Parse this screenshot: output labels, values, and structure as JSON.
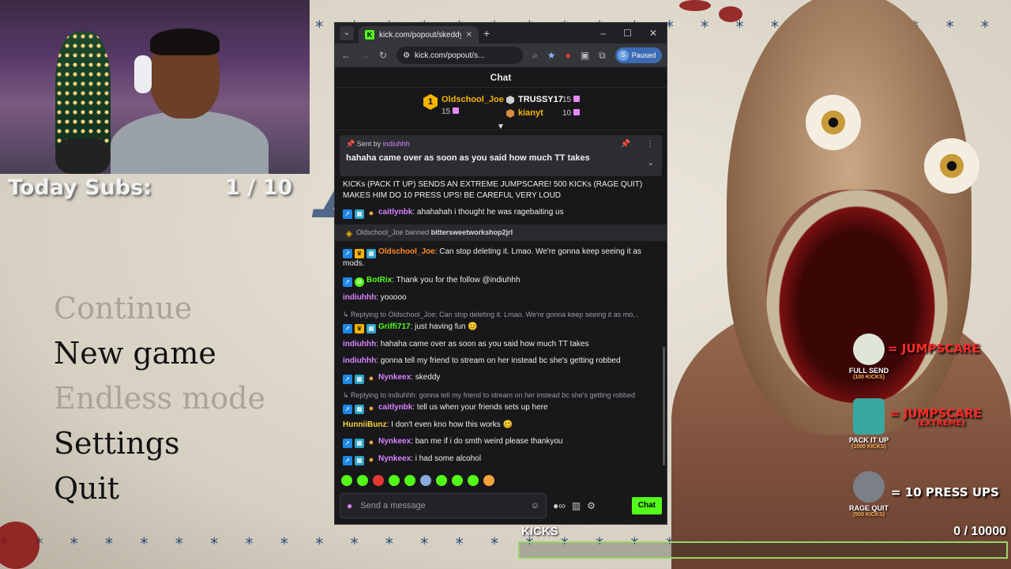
{
  "overlay": {
    "today_subs_label": "Today Subs:",
    "today_subs_value": "1 / 10",
    "kicks_label": "KICKS",
    "kicks_value": "0  / 10000",
    "kicks_progress": 0.0
  },
  "game_menu": {
    "items": [
      {
        "label": "Continue",
        "enabled": false
      },
      {
        "label": "New game",
        "enabled": true
      },
      {
        "label": "Endless mode",
        "enabled": false
      },
      {
        "label": "Settings",
        "enabled": true
      },
      {
        "label": "Quit",
        "enabled": true
      }
    ]
  },
  "rewards": [
    {
      "name": "FULL SEND",
      "cost": "(100 KICKS)",
      "effect": "= JUMPSCARE",
      "sub": ""
    },
    {
      "name": "PACK IT UP",
      "cost": "(1000 KICKS)",
      "effect": "= JUMPSCARE",
      "sub": "(EXTREME)"
    },
    {
      "name": "RAGE QUIT",
      "cost": "(500 KICKS)",
      "effect": "= 10 PRESS UPS",
      "sub": ""
    }
  ],
  "browser": {
    "tab_title": "kick.com/popout/skeddyk/chat",
    "address": "kick.com/popout/s...",
    "profile_initial": "S",
    "profile_status": "Paused",
    "chat_header": "Chat"
  },
  "leaderboard": {
    "first": {
      "rank": "1",
      "name": "Oldschool_Joe",
      "value": "15"
    },
    "second": {
      "name": "TRUSSY17",
      "value": "15"
    },
    "third": {
      "name": "kianyt",
      "value": "10"
    }
  },
  "pinned": {
    "sent_by_label": "Sent by",
    "sent_by_user": "indiuhhh",
    "message": "hahaha came over as soon as you said how much TT takes"
  },
  "feed": {
    "announcement": "KICKs (PACK IT UP) SENDS AN EXTREME JUMPSCARE! 500 KICKs (RAGE QUIT) MAKES HIM DO 10 PRESS UPS! BE CAREFUL VERY LOUD",
    "m1": {
      "user": "caitlynbk",
      "text": ": ahahahah i thought he was ragebaiting us"
    },
    "ban": {
      "mod": "Oldschool_Joe",
      "action": "banned",
      "target": "bittersweetworkshop2jrl"
    },
    "m2": {
      "user": "Oldschool_Joe",
      "text": ": Can stop deleting it. Lmao. We're gonna keep seeing it as mods."
    },
    "m3": {
      "user": "BotRix",
      "text": ": Thank you for the follow @indiuhhh"
    },
    "m4": {
      "user": "indiuhhh",
      "text": ": yooooo"
    },
    "m5": {
      "reply": "Replying to Oldschool_Joe: Can stop deleting it. Lmao. We're gonna keep seeing it as mo...",
      "user": "Griffi717",
      "text": ": just having fun"
    },
    "m6": {
      "user": "indiuhhh",
      "text": ": hahaha came over as soon as you said how much TT takes"
    },
    "m7": {
      "user": "indiuhhh",
      "text": ": gonna tell my friend to stream on her instead bc she's getting robbed"
    },
    "m8": {
      "user": "Nynkeex",
      "text": ": skeddy"
    },
    "m9": {
      "reply": "Replying to indiuhhh: gonna tell my friend to stream on her instead bc she's getting robbed",
      "user": "caitlynbk",
      "text": ": tell us when your friends sets up here"
    },
    "m10": {
      "user": "HunniiBunz",
      "text": ": I don't even kno how this works"
    },
    "m11": {
      "user": "Nynkeex",
      "text": ": ban me if i do smth weird please thankyou"
    },
    "m12": {
      "user": "Nynkeex",
      "text": ": i had some alcohol"
    }
  },
  "input": {
    "placeholder": "Send a message",
    "send_label": "Chat"
  },
  "colors": {
    "kick_green": "#53fc18",
    "user_purple": "#d883ff",
    "user_orange": "#ff8a1e",
    "user_green": "#53fc18",
    "user_yellow": "#f4d03f",
    "reward_red": "#ff2a2a"
  }
}
